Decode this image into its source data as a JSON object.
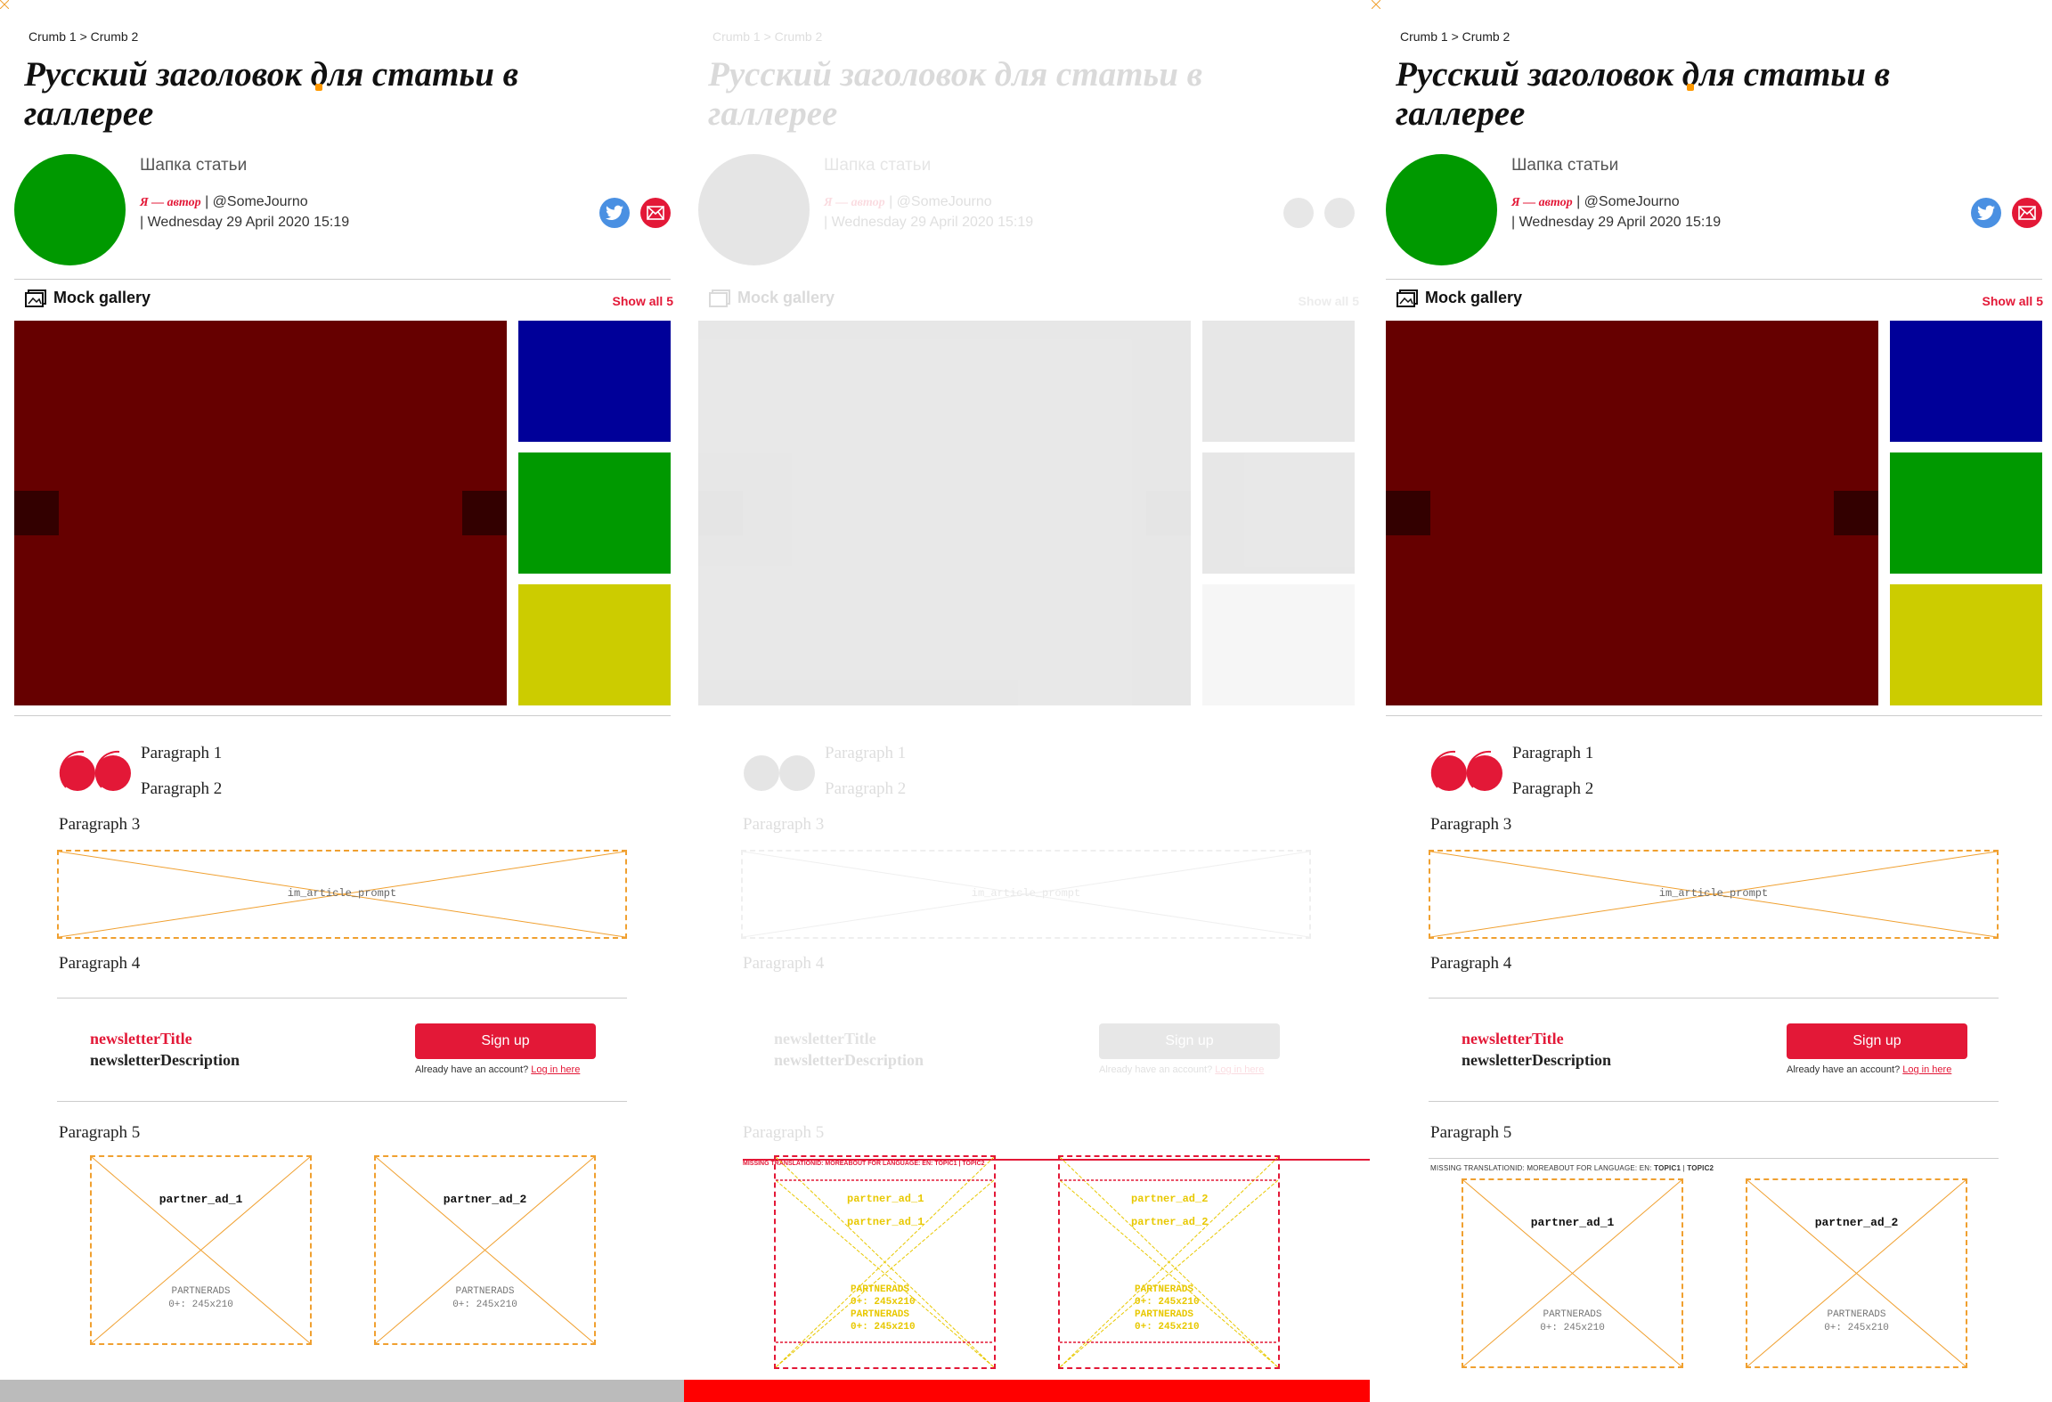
{
  "breadcrumb": {
    "crumb1": "Crumb 1",
    "separator": ">",
    "crumb2": "Crumb 2"
  },
  "article": {
    "title": "Русский заголовок для статьи в галлерее",
    "standfirst": "Шапка статьи",
    "author_name": "Я — автор",
    "author_handle": "| @SomeJourno",
    "date": "| Wednesday 29 April 2020 15:19"
  },
  "share": {
    "twitter_icon": "twitter-icon",
    "email_icon": "envelope-icon"
  },
  "gallery": {
    "title": "Mock gallery",
    "show_all": "Show all 5",
    "main_color": "#660000",
    "thumb_colors": [
      "#000099",
      "#009900",
      "#cccc00"
    ]
  },
  "paragraphs": {
    "p1": "Paragraph 1",
    "p2": "Paragraph 2",
    "p3": "Paragraph 3",
    "p4": "Paragraph 4",
    "p5": "Paragraph 5"
  },
  "prompt": {
    "label": "im_article_prompt"
  },
  "newsletter": {
    "title": "newsletterTitle",
    "description": "newsletterDescription",
    "signup": "Sign up",
    "already": "Already have an account?",
    "login": "Log in here"
  },
  "missing_translation": {
    "text": "MISSING TRANSLATIONID: MOREABOUT FOR LANGUAGE: EN:",
    "topic1": "TOPIC1",
    "sep": "|",
    "topic2": "TOPIC2"
  },
  "ads": [
    {
      "name": "partner_ad_1",
      "label": "PARTNERADS",
      "size": "0+: 245x210"
    },
    {
      "name": "partner_ad_2",
      "label": "PARTNERADS",
      "size": "0+: 245x210"
    }
  ],
  "colors": {
    "accent": "#e31837",
    "ad_outline": "#f0a030",
    "diff_bar_left": "#bbbbbb",
    "diff_bar_middle": "#ff0000"
  }
}
